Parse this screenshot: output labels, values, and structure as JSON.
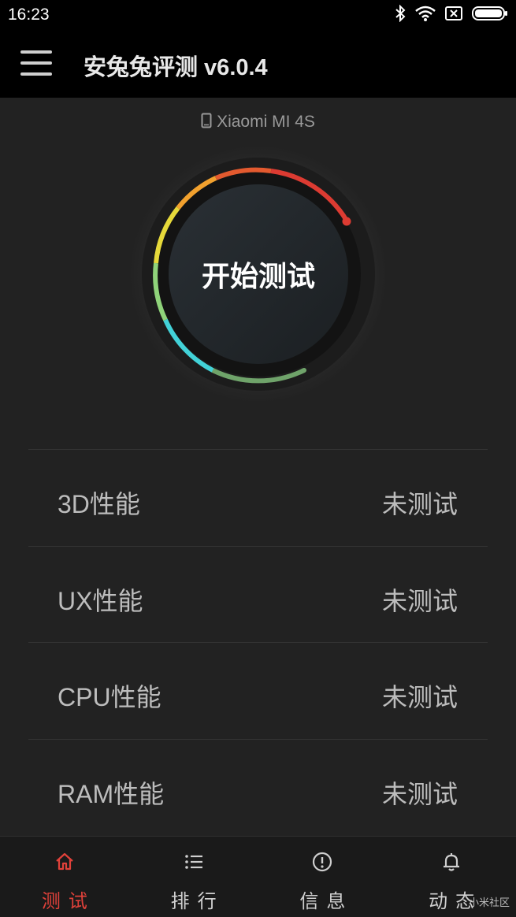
{
  "status_bar": {
    "time": "16:23"
  },
  "app_bar": {
    "title": "安兔兔评测 v6.0.4"
  },
  "device": {
    "name": "Xiaomi MI 4S"
  },
  "dial": {
    "start_label": "开始测试"
  },
  "results": [
    {
      "name": "3D性能",
      "status": "未测试"
    },
    {
      "name": "UX性能",
      "status": "未测试"
    },
    {
      "name": "CPU性能",
      "status": "未测试"
    },
    {
      "name": "RAM性能",
      "status": "未测试"
    }
  ],
  "bottom_nav": [
    {
      "label": "测试",
      "icon": "home-icon",
      "active": true
    },
    {
      "label": "排行",
      "icon": "list-icon",
      "active": false
    },
    {
      "label": "信息",
      "icon": "info-icon",
      "active": false
    },
    {
      "label": "动态",
      "icon": "bell-icon",
      "active": false
    }
  ],
  "watermark": "小米社区",
  "colors": {
    "accent": "#e0413a",
    "background": "#222222",
    "bar": "#000000"
  }
}
